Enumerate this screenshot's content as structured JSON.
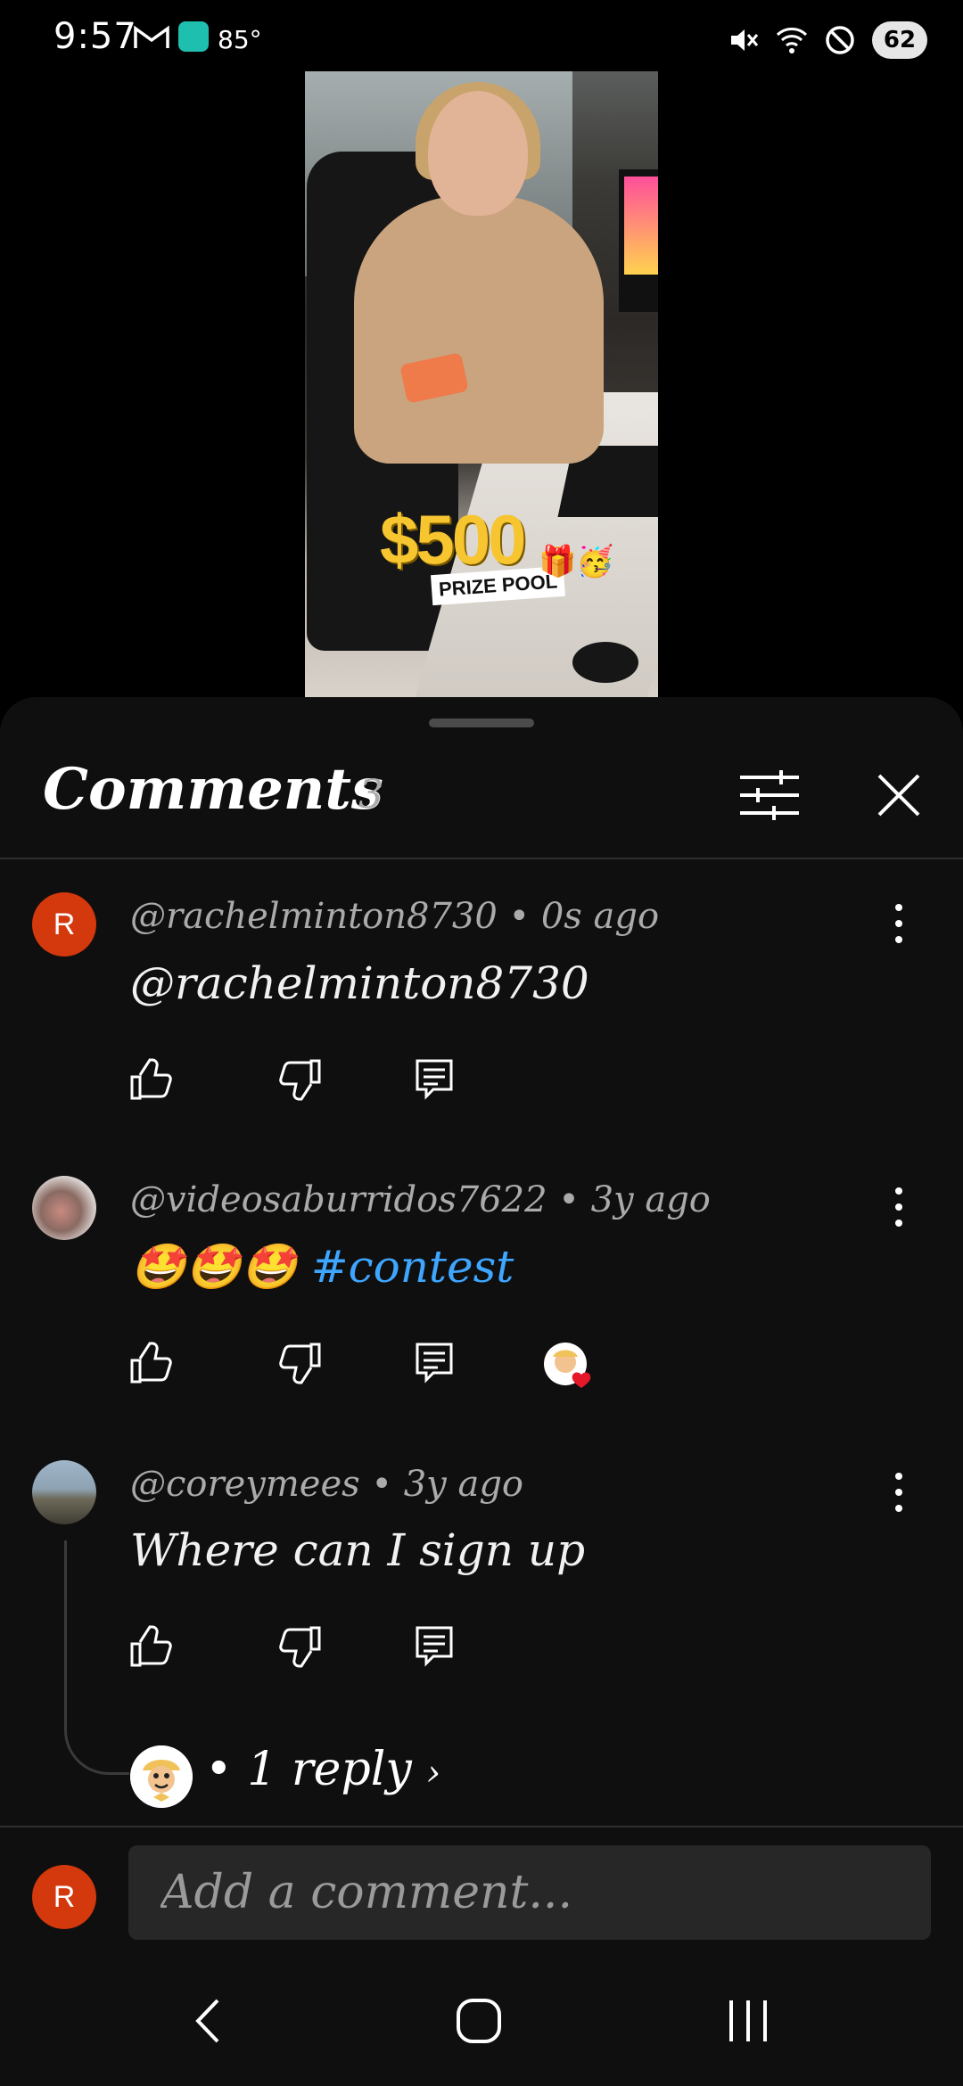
{
  "status_bar": {
    "time": "9:57",
    "temperature": "85°",
    "battery": "62",
    "icons": [
      "gmail-icon",
      "app-notification-icon",
      "mute-icon",
      "wifi-icon",
      "do-not-disturb-icon"
    ]
  },
  "video": {
    "prize_amount": "$500",
    "prize_label": "PRIZE POOL",
    "prize_emoji": "🎁🥳"
  },
  "comments_panel": {
    "title": "Comments",
    "count": "3",
    "comments": [
      {
        "avatar_letter": "R",
        "author": "@rachelminton8730",
        "time": "0s ago",
        "text": "@rachelminton8730"
      },
      {
        "author": "@videosaburridos7622",
        "time": "3y ago",
        "emoji": "🤩🤩🤩",
        "hashtag": "#contest"
      },
      {
        "author": "@coreymees",
        "time": "3y ago",
        "text": "Where can I sign up",
        "replies_label": "1 reply"
      }
    ]
  },
  "comment_box": {
    "avatar_letter": "R",
    "placeholder": "Add a comment..."
  },
  "colors": {
    "panel_bg": "#0f0f0f",
    "hashtag": "#3ea6ff",
    "avatar_r": "#d4380d",
    "prize_yellow": "#f7c530"
  }
}
